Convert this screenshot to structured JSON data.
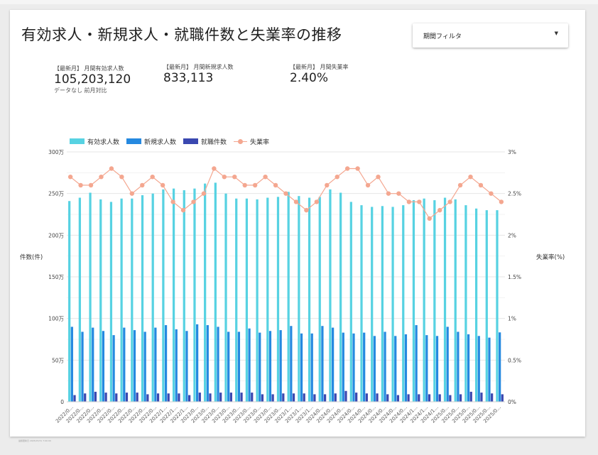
{
  "dashboard": {
    "title": "有効求人・新規求人・就職件数と失業率の推移",
    "filter": {
      "label": "期間フィルタ",
      "caret": "▼"
    },
    "kpis": [
      {
        "label": "【最新月】 月間有効求人数",
        "value": "105,203,120",
        "sub": "データなし 前月対比"
      },
      {
        "label": "【最新月】 月間新規求人数",
        "value": "833,113",
        "sub": ""
      },
      {
        "label": "【最新月】 月間失業率",
        "value": "2.40%",
        "sub": ""
      }
    ],
    "footer_note": "最終更新日 2025/07/31 7:00:00"
  },
  "chart_data": {
    "type": "bar",
    "x_tick_labels": [
      "2022/0...",
      "2022/0...",
      "2022/0...",
      "2022/0...",
      "2022/0...",
      "2022/0...",
      "2022/0...",
      "2022/0...",
      "2022/0...",
      "2022/1...",
      "2022/1...",
      "2022/1...",
      "2023/0...",
      "2023/0...",
      "2023/0...",
      "2023/0...",
      "2023/0...",
      "2023/0...",
      "2023/0...",
      "2023/0...",
      "2023/0...",
      "2023/1...",
      "2023/1...",
      "2023/1...",
      "2024/0...",
      "2024/0...",
      "2024/0...",
      "2024/0...",
      "2024/0...",
      "2024/0...",
      "2024/0...",
      "2024/0...",
      "2024/0...",
      "2024/1...",
      "2024/1...",
      "2024/1...",
      "2025/0...",
      "2025/0...",
      "2025/0...",
      "2025/0...",
      "2025/0...",
      "2025/0..."
    ],
    "series": [
      {
        "name": "有効求人数",
        "type": "bar",
        "axis": "left",
        "color": "#57d2e2",
        "values": [
          2410000,
          2450000,
          2510000,
          2430000,
          2400000,
          2440000,
          2440000,
          2480000,
          2500000,
          2550000,
          2560000,
          2540000,
          2560000,
          2620000,
          2630000,
          2500000,
          2440000,
          2440000,
          2430000,
          2450000,
          2460000,
          2520000,
          2470000,
          2450000,
          2460000,
          2550000,
          2510000,
          2400000,
          2360000,
          2340000,
          2350000,
          2340000,
          2360000,
          2420000,
          2440000,
          2420000,
          2450000,
          2430000,
          2360000,
          2320000,
          2300000,
          2300000
        ]
      },
      {
        "name": "新規求人数",
        "type": "bar",
        "axis": "left",
        "color": "#2589e0",
        "values": [
          900000,
          840000,
          890000,
          850000,
          800000,
          890000,
          860000,
          840000,
          890000,
          920000,
          870000,
          850000,
          930000,
          920000,
          900000,
          840000,
          840000,
          880000,
          830000,
          850000,
          860000,
          910000,
          820000,
          820000,
          910000,
          890000,
          830000,
          820000,
          830000,
          790000,
          840000,
          790000,
          810000,
          920000,
          800000,
          790000,
          900000,
          840000,
          810000,
          790000,
          770000,
          833113
        ]
      },
      {
        "name": "就職件数",
        "type": "bar",
        "axis": "left",
        "color": "#3a48b0",
        "values": [
          80000,
          100000,
          120000,
          110000,
          100000,
          110000,
          110000,
          90000,
          100000,
          100000,
          100000,
          80000,
          110000,
          100000,
          110000,
          110000,
          110000,
          110000,
          90000,
          90000,
          100000,
          100000,
          100000,
          90000,
          90000,
          100000,
          130000,
          110000,
          100000,
          100000,
          90000,
          80000,
          90000,
          90000,
          90000,
          90000,
          80000,
          90000,
          120000,
          110000,
          100000,
          90000
        ]
      },
      {
        "name": "失業率",
        "type": "line",
        "axis": "right",
        "color": "#f4a790",
        "values": [
          2.7,
          2.6,
          2.6,
          2.7,
          2.8,
          2.7,
          2.5,
          2.6,
          2.7,
          2.6,
          2.4,
          2.3,
          2.4,
          2.5,
          2.8,
          2.7,
          2.7,
          2.6,
          2.6,
          2.7,
          2.6,
          2.5,
          2.4,
          2.3,
          2.4,
          2.6,
          2.7,
          2.8,
          2.8,
          2.6,
          2.7,
          2.5,
          2.5,
          2.4,
          2.4,
          2.2,
          2.3,
          2.4,
          2.6,
          2.7,
          2.6,
          2.5,
          2.4
        ]
      }
    ],
    "left_axis": {
      "label": "件数(件)",
      "min": 0,
      "max": 3000000,
      "ticks": [
        0,
        500000,
        1000000,
        1500000,
        2000000,
        2500000,
        3000000
      ],
      "tick_labels": [
        "0",
        "50万",
        "100万",
        "150万",
        "200万",
        "250万",
        "300万"
      ]
    },
    "right_axis": {
      "label": "失業率(%)",
      "min": 0,
      "max": 3,
      "ticks": [
        0,
        0.5,
        1,
        1.5,
        2,
        2.5,
        3
      ],
      "tick_labels": [
        "0%",
        "0.5%",
        "1%",
        "1.5%",
        "2%",
        "2.5%",
        "3%"
      ]
    },
    "grid": true,
    "legend_position": "top-left"
  }
}
